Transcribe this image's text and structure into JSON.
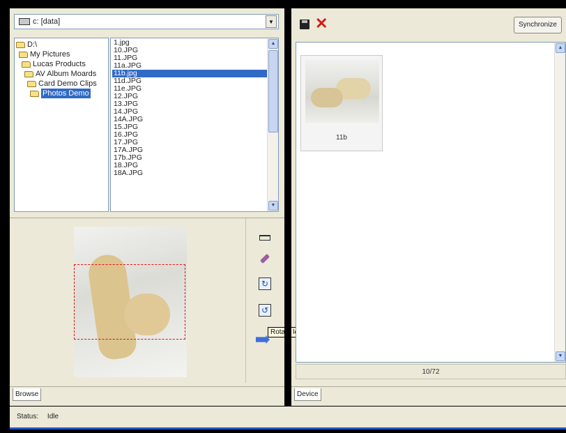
{
  "drive": {
    "label": "c: [data]"
  },
  "folder_tree": [
    {
      "label": "D:\\"
    },
    {
      "label": "My Pictures"
    },
    {
      "label": "Lucas Products"
    },
    {
      "label": "AV Album Moards"
    },
    {
      "label": "Card Demo Clips"
    },
    {
      "label": "Photos Demo",
      "selected": true
    }
  ],
  "files": [
    {
      "name": "1.jpg"
    },
    {
      "name": "10.JPG"
    },
    {
      "name": "11.JPG"
    },
    {
      "name": "11a.JPG"
    },
    {
      "name": "11b.jpg",
      "selected": true
    },
    {
      "name": "11d.JPG"
    },
    {
      "name": "11e.JPG"
    },
    {
      "name": "12.JPG"
    },
    {
      "name": "13.JPG"
    },
    {
      "name": "14.JPG"
    },
    {
      "name": "14A.JPG"
    },
    {
      "name": "15.JPG"
    },
    {
      "name": "16.JPG"
    },
    {
      "name": "17.JPG"
    },
    {
      "name": "17A.JPG"
    },
    {
      "name": "17b.JPG"
    },
    {
      "name": "18.JPG"
    },
    {
      "name": "18A.JPG"
    }
  ],
  "preview": {
    "tooltip": "Rotate left"
  },
  "left_tabs": [
    {
      "label": "Browse"
    }
  ],
  "toolbar": {
    "synchronize_label": "Synchronize"
  },
  "device": {
    "thumbnails": [
      {
        "label": "11b"
      }
    ],
    "page_counter": "10/72"
  },
  "right_tabs": [
    {
      "label": "Device"
    }
  ],
  "status": {
    "label": "Status:",
    "value": "Idle"
  },
  "colors": {
    "selection": "#316ac5",
    "delete": "#d31a1a",
    "crop": "#dd1111"
  },
  "icons": [
    "drive-icon",
    "folder-icon",
    "save-icon",
    "delete-icon",
    "crop-icon",
    "eraser-icon",
    "rotate-right-icon",
    "rotate-left-icon",
    "arrow-icon"
  ]
}
